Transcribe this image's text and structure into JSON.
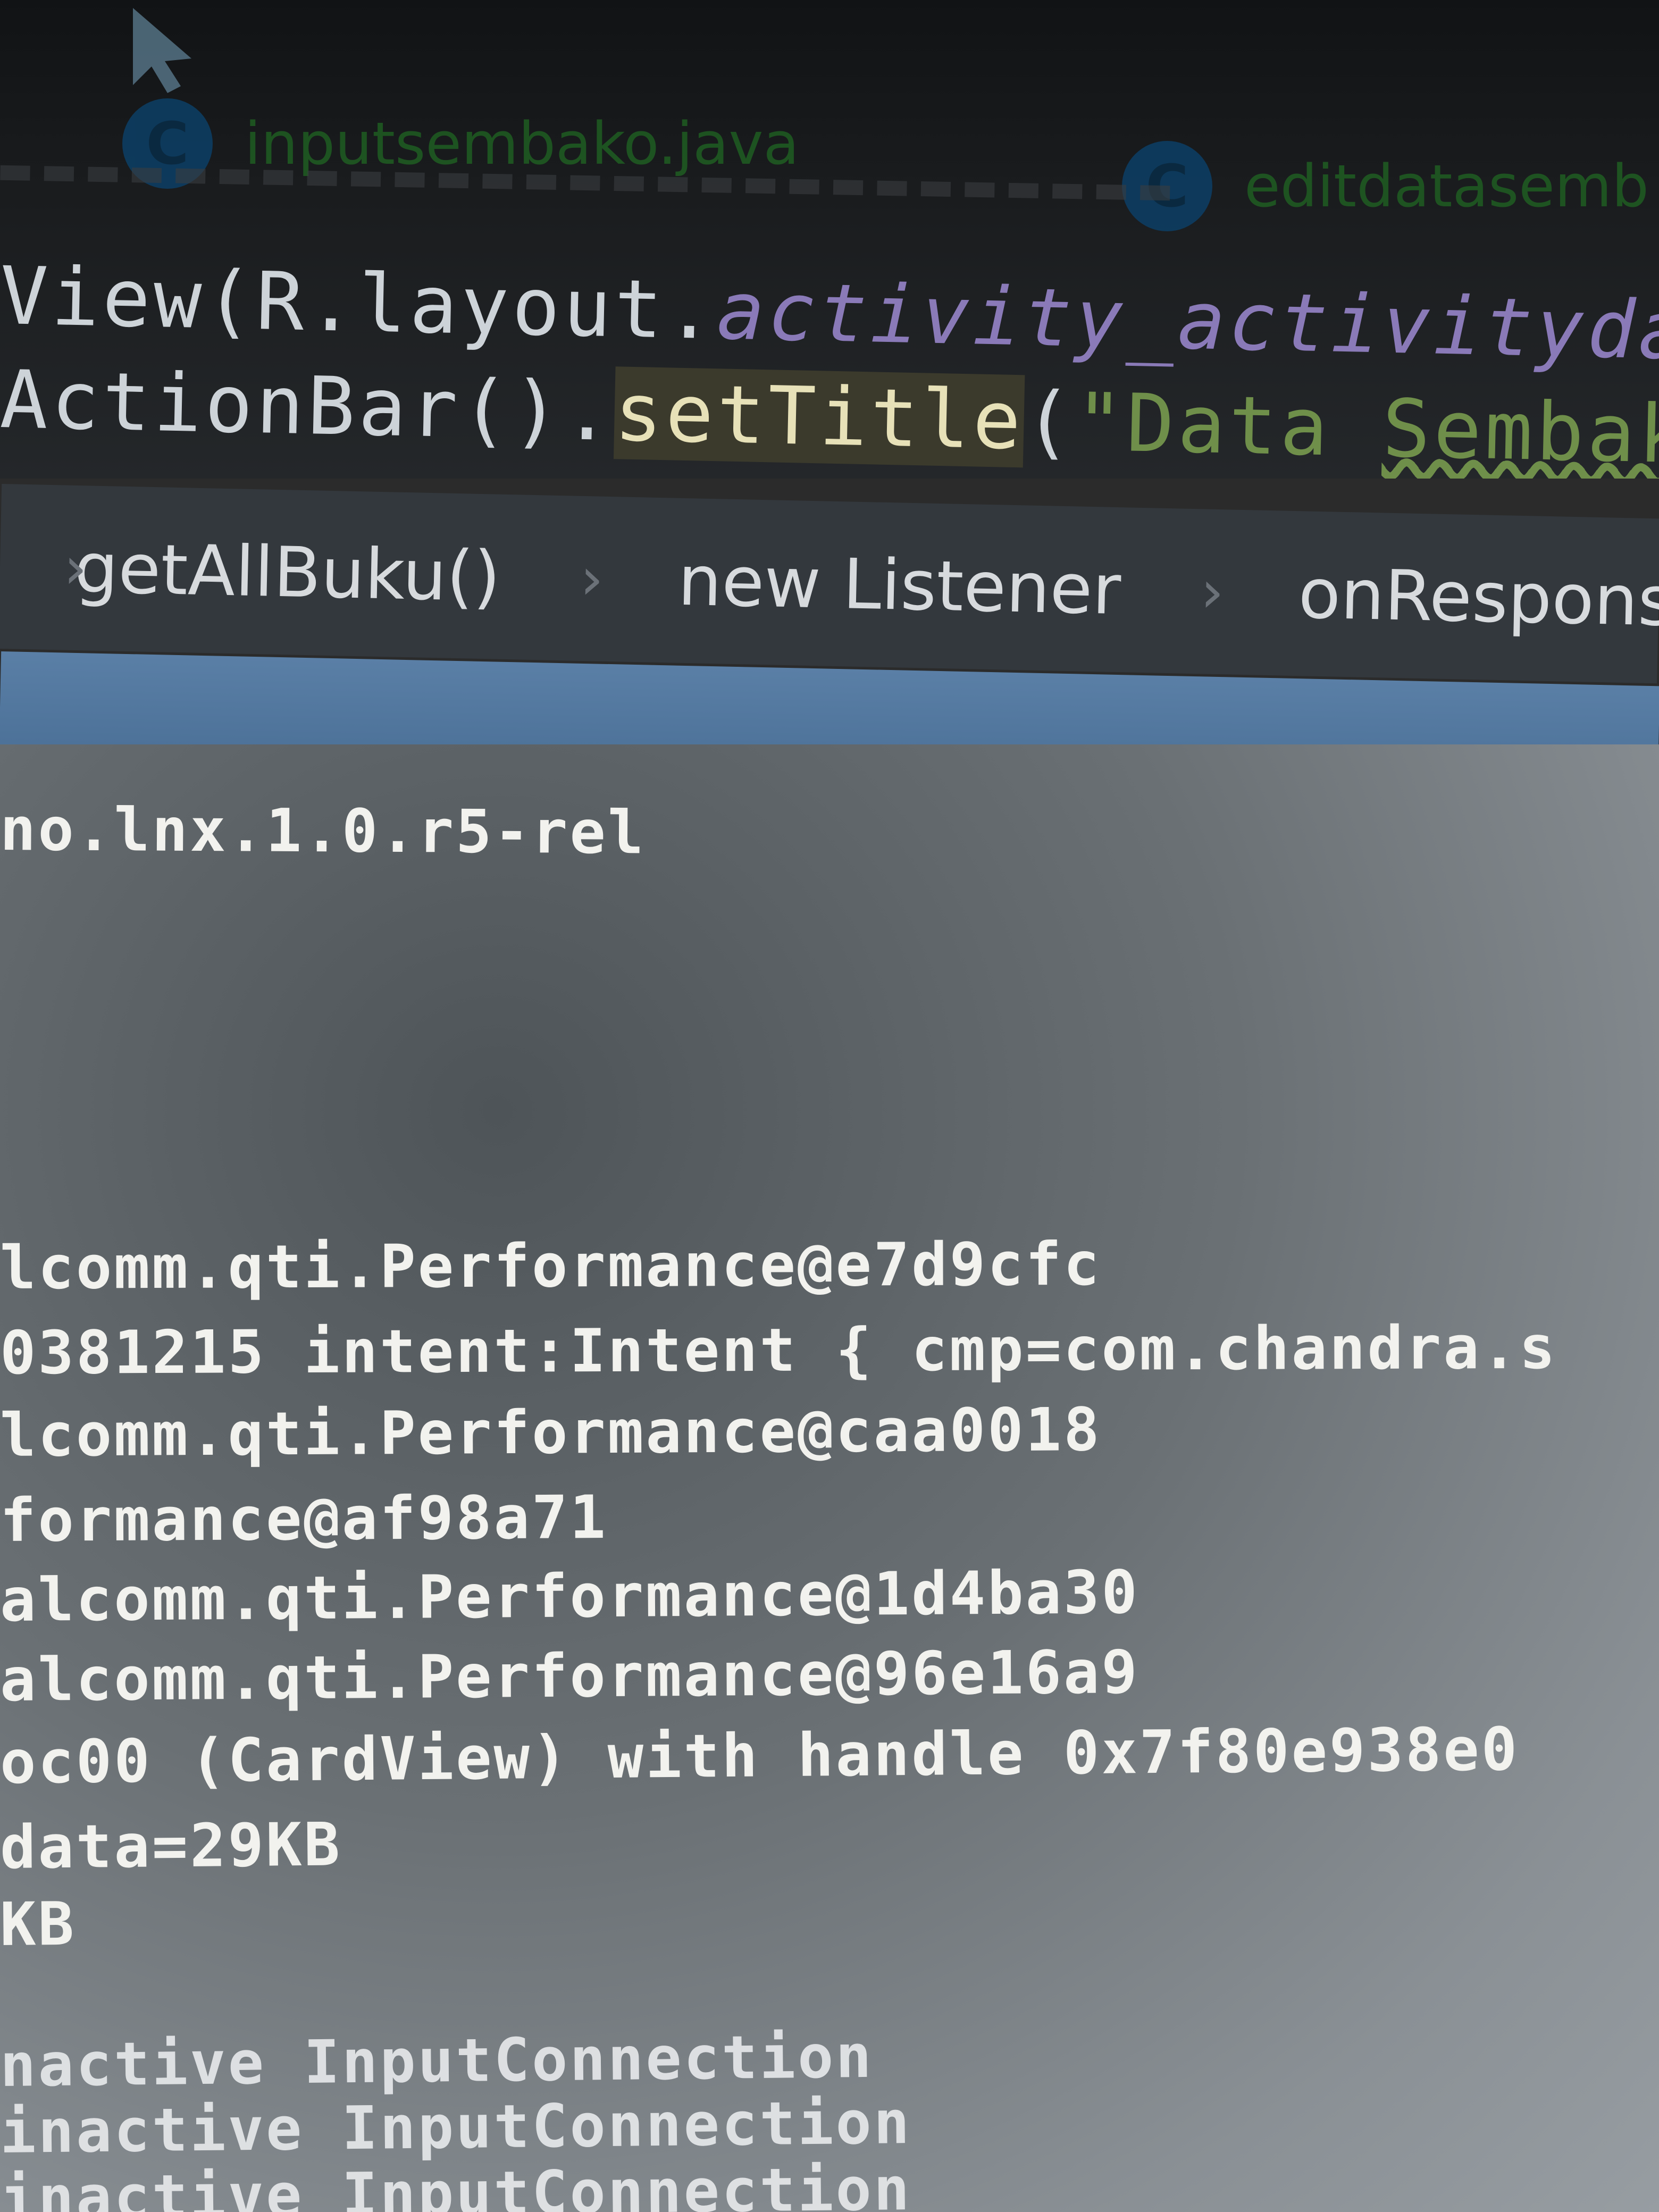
{
  "tabs": [
    {
      "label": "inputsembako.java",
      "icon": "java-class-icon"
    },
    {
      "label": "editdatasemb",
      "icon": "java-class-icon"
    }
  ],
  "code": {
    "line1": {
      "prefix": "View(R.layout.",
      "italic": "activity_activitydatasen"
    },
    "line2": {
      "prefix": "ActionBar().",
      "method": "setTitle",
      "open": "(",
      "string_open": "\"Data ",
      "string_word": "Sembako",
      "string_close": "\"",
      "close": ")",
      "semicolon": ";"
    }
  },
  "breadcrumb": {
    "items": [
      "getAllBuku()",
      "new Listener",
      "onResponse()"
    ],
    "separator": "›"
  },
  "logcat": {
    "lines": [
      "no.lnx.1.0.r5-rel",
      "lcomm.qti.Performance@e7d9cfc",
      "0381215 intent:Intent { cmp=com.chandra.s",
      "lcomm.qti.Performance@caa0018",
      "formance@af98a71",
      "alcomm.qti.Performance@1d4ba30",
      "alcomm.qti.Performance@96e16a9",
      "oc00 (CardView) with handle 0x7f80e938e0",
      " data=29KB",
      "KB",
      "nactive InputConnection",
      "inactive InputConnection",
      "inactive InputConnection"
    ]
  },
  "colors": {
    "editor_bg": "#1a1c1e",
    "breadcrumb_bg": "#33383d",
    "toolbar_blue": "#5a7fa6",
    "logcat_bg": "#8a9095",
    "log_text": "#f2f2ee"
  }
}
